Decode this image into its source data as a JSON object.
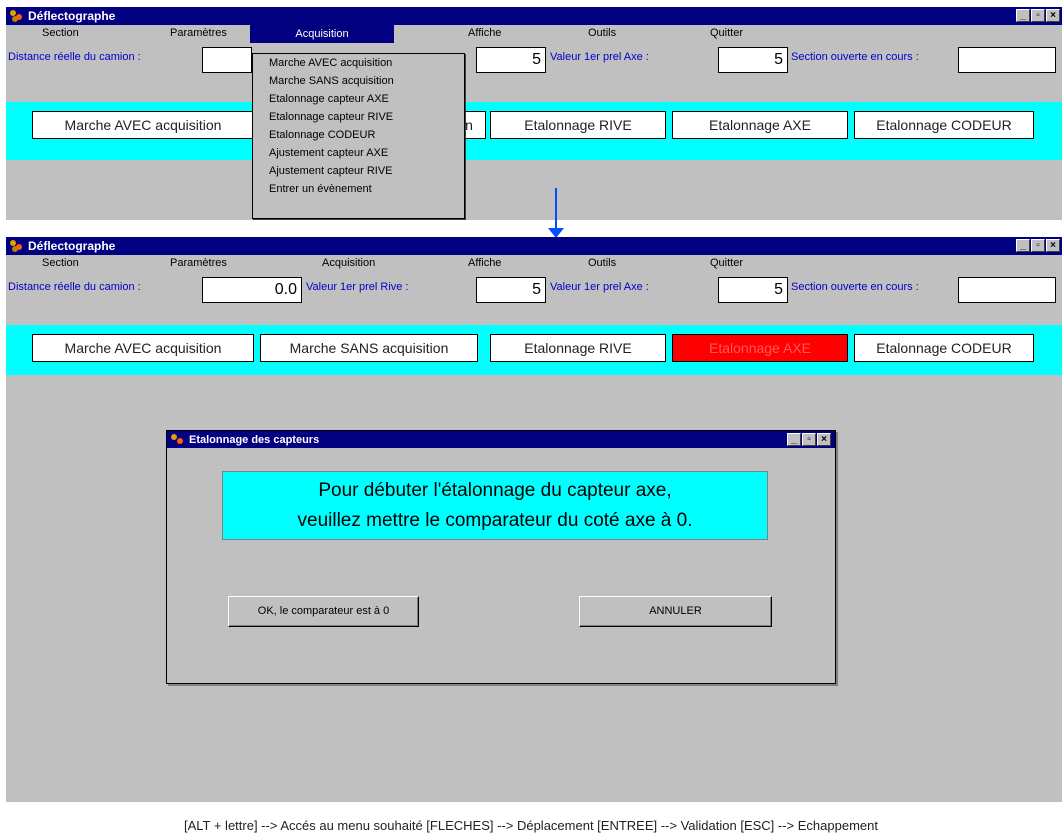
{
  "app": {
    "title": "Déflectographe"
  },
  "menus": [
    "Section",
    "Paramètres",
    "Acquisition",
    "Affiche",
    "Outils",
    "Quitter"
  ],
  "fields": {
    "distance_label": "Distance réelle du camion :",
    "distance_value_top": "",
    "distance_value": "0.0",
    "rive_label": "Valeur 1er prel Rive :",
    "rive_value": "5",
    "axe_label": "Valeur 1er prel Axe :",
    "axe_value": "5",
    "section_label": "Section ouverte en cours :",
    "section_value": ""
  },
  "buttons_top": [
    "Marche AVEC acquisition",
    "n",
    "Etalonnage RIVE",
    "Etalonnage AXE",
    "Etalonnage CODEUR"
  ],
  "buttons": [
    "Marche AVEC acquisition",
    "Marche SANS acquisition",
    "Etalonnage RIVE",
    "Etalonnage AXE",
    "Etalonnage CODEUR"
  ],
  "acquisition_menu": [
    "Marche AVEC acquisition",
    "Marche SANS acquisition",
    "Etalonnage capteur AXE",
    "Etalonnage capteur RIVE",
    "Etalonnage CODEUR",
    "Ajustement capteur AXE",
    "Ajustement capteur RIVE",
    "Entrer un évènement"
  ],
  "dialog": {
    "title": "Etalonnage des capteurs",
    "message_line1": "Pour débuter l'étalonnage du capteur axe,",
    "message_line2": "veuillez mettre le comparateur du coté axe à 0.",
    "ok_label": "OK, le comparateur est à 0",
    "cancel_label": "ANNULER"
  },
  "statusbar": "[ALT + lettre] --> Accés au menu souhaité   [FLECHES] --> Déplacement   [ENTREE] --> Validation  [ESC] --> Echappement",
  "colors": {
    "titlebar": "#000080",
    "cyan_band": "#00ffff",
    "active_button": "#ff0000",
    "arrow": "#0050ff"
  }
}
